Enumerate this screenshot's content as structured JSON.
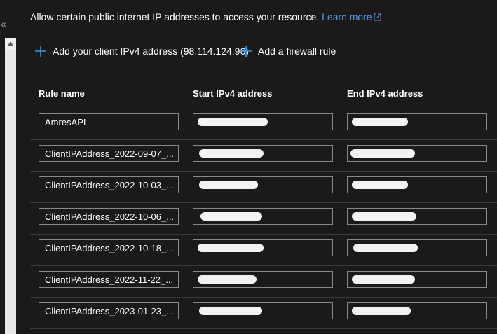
{
  "info": {
    "text": "Allow certain public internet IP addresses to access your resource.",
    "learn_more": "Learn more"
  },
  "actions": {
    "add_client": "Add your client IPv4 address (98.114.124.96)",
    "add_rule": "Add a firewall rule"
  },
  "grid": {
    "headers": {
      "rule_name": "Rule name",
      "start_ip": "Start IPv4 address",
      "end_ip": "End IPv4 address"
    },
    "rows": [
      {
        "rule_name": "AmresAPI"
      },
      {
        "rule_name": "ClientIPAddress_2022-09-07_..."
      },
      {
        "rule_name": "ClientIPAddress_2022-10-03_..."
      },
      {
        "rule_name": "ClientIPAddress_2022-10-06_..."
      },
      {
        "rule_name": "ClientIPAddress_2022-10-18_..."
      },
      {
        "rule_name": "ClientIPAddress_2022-11-22_..."
      },
      {
        "rule_name": "ClientIPAddress_2023-01-23_..."
      }
    ]
  },
  "colors": {
    "background": "#1b1a19",
    "link": "#479ef5",
    "accent": "#2899f5",
    "border": "#8a8886"
  },
  "icons": {
    "collapse": "double-chevron-left-icon",
    "external": "external-link-icon",
    "add": "plus-icon"
  }
}
